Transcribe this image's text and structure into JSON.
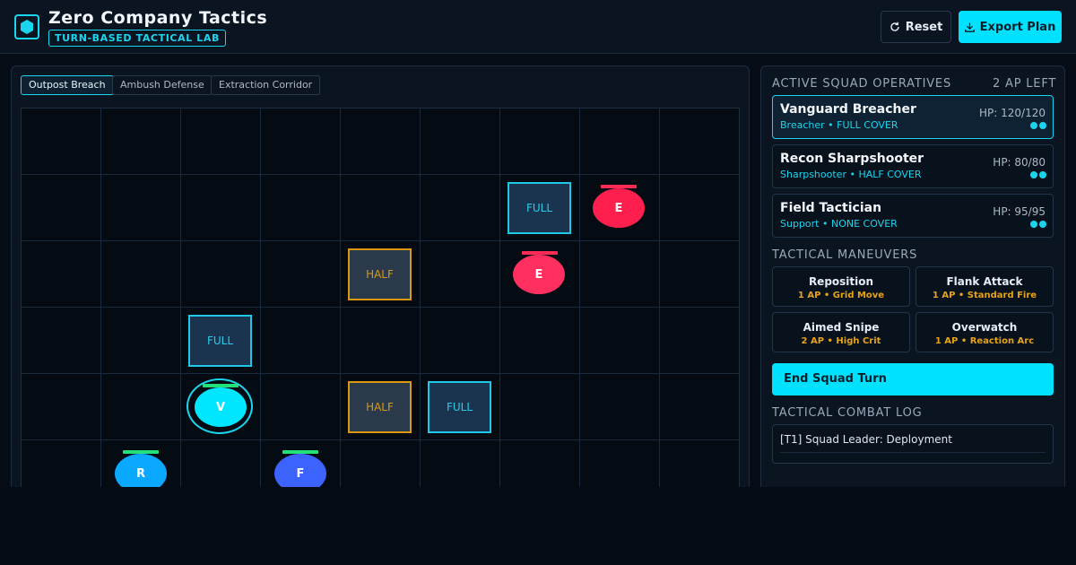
{
  "header": {
    "title": "Zero Company Tactics",
    "subtitle": "TURN-BASED TACTICAL LAB",
    "reset_label": "Reset",
    "export_label": "Export Plan",
    "logo_icon": "hexagon-icon",
    "accent_color": "#00e1ff"
  },
  "tabs": [
    {
      "label": "Outpost Breach",
      "active": true
    },
    {
      "label": "Ambush Defense",
      "active": false
    },
    {
      "label": "Extraction Corridor",
      "active": false
    }
  ],
  "board": {
    "columns": 9,
    "covers": [
      {
        "label": "FULL",
        "type": "full",
        "col": 6,
        "row": 1
      },
      {
        "label": "HALF",
        "type": "half",
        "col": 4,
        "row": 2
      },
      {
        "label": "FULL",
        "type": "full",
        "col": 2,
        "row": 3
      },
      {
        "label": "HALF",
        "type": "half",
        "col": 4,
        "row": 4
      },
      {
        "label": "FULL",
        "type": "full",
        "col": 5,
        "row": 4
      }
    ],
    "units": [
      {
        "label": "E",
        "team": "enemy",
        "col": 7,
        "row": 1,
        "color": "#ff1f4f"
      },
      {
        "label": "E",
        "team": "enemy",
        "col": 6,
        "row": 2,
        "color": "#ff2f60"
      },
      {
        "label": "V",
        "team": "squad",
        "col": 2,
        "row": 4,
        "color": "#00e6ff",
        "selected": true
      },
      {
        "label": "R",
        "team": "squad",
        "col": 1,
        "row": 5,
        "color": "#0aa8ff"
      },
      {
        "label": "F",
        "team": "squad",
        "col": 3,
        "row": 5,
        "color": "#3d63ff"
      }
    ]
  },
  "squad": {
    "title": "ACTIVE SQUAD OPERATIVES",
    "ap_left": "2 AP LEFT",
    "operatives": [
      {
        "name": "Vanguard Breacher",
        "role": "Breacher • FULL COVER",
        "hp": "HP: 120/120",
        "active": true
      },
      {
        "name": "Recon Sharpshooter",
        "role": "Sharpshooter • HALF COVER",
        "hp": "HP: 80/80",
        "active": false
      },
      {
        "name": "Field Tactician",
        "role": "Support • NONE COVER",
        "hp": "HP: 95/95",
        "active": false
      }
    ]
  },
  "maneuvers": {
    "title": "TACTICAL MANEUVERS",
    "items": [
      {
        "name": "Reposition",
        "cost": "1 AP • Grid Move"
      },
      {
        "name": "Flank Attack",
        "cost": "1 AP • Standard Fire"
      },
      {
        "name": "Aimed Snipe",
        "cost": "2 AP • High Crit"
      },
      {
        "name": "Overwatch",
        "cost": "1 AP • Reaction Arc"
      }
    ]
  },
  "end_turn_label": "End Squad Turn",
  "log": {
    "title": "TACTICAL COMBAT LOG",
    "entries": [
      "[T1] Squad Leader: Deployment"
    ]
  }
}
